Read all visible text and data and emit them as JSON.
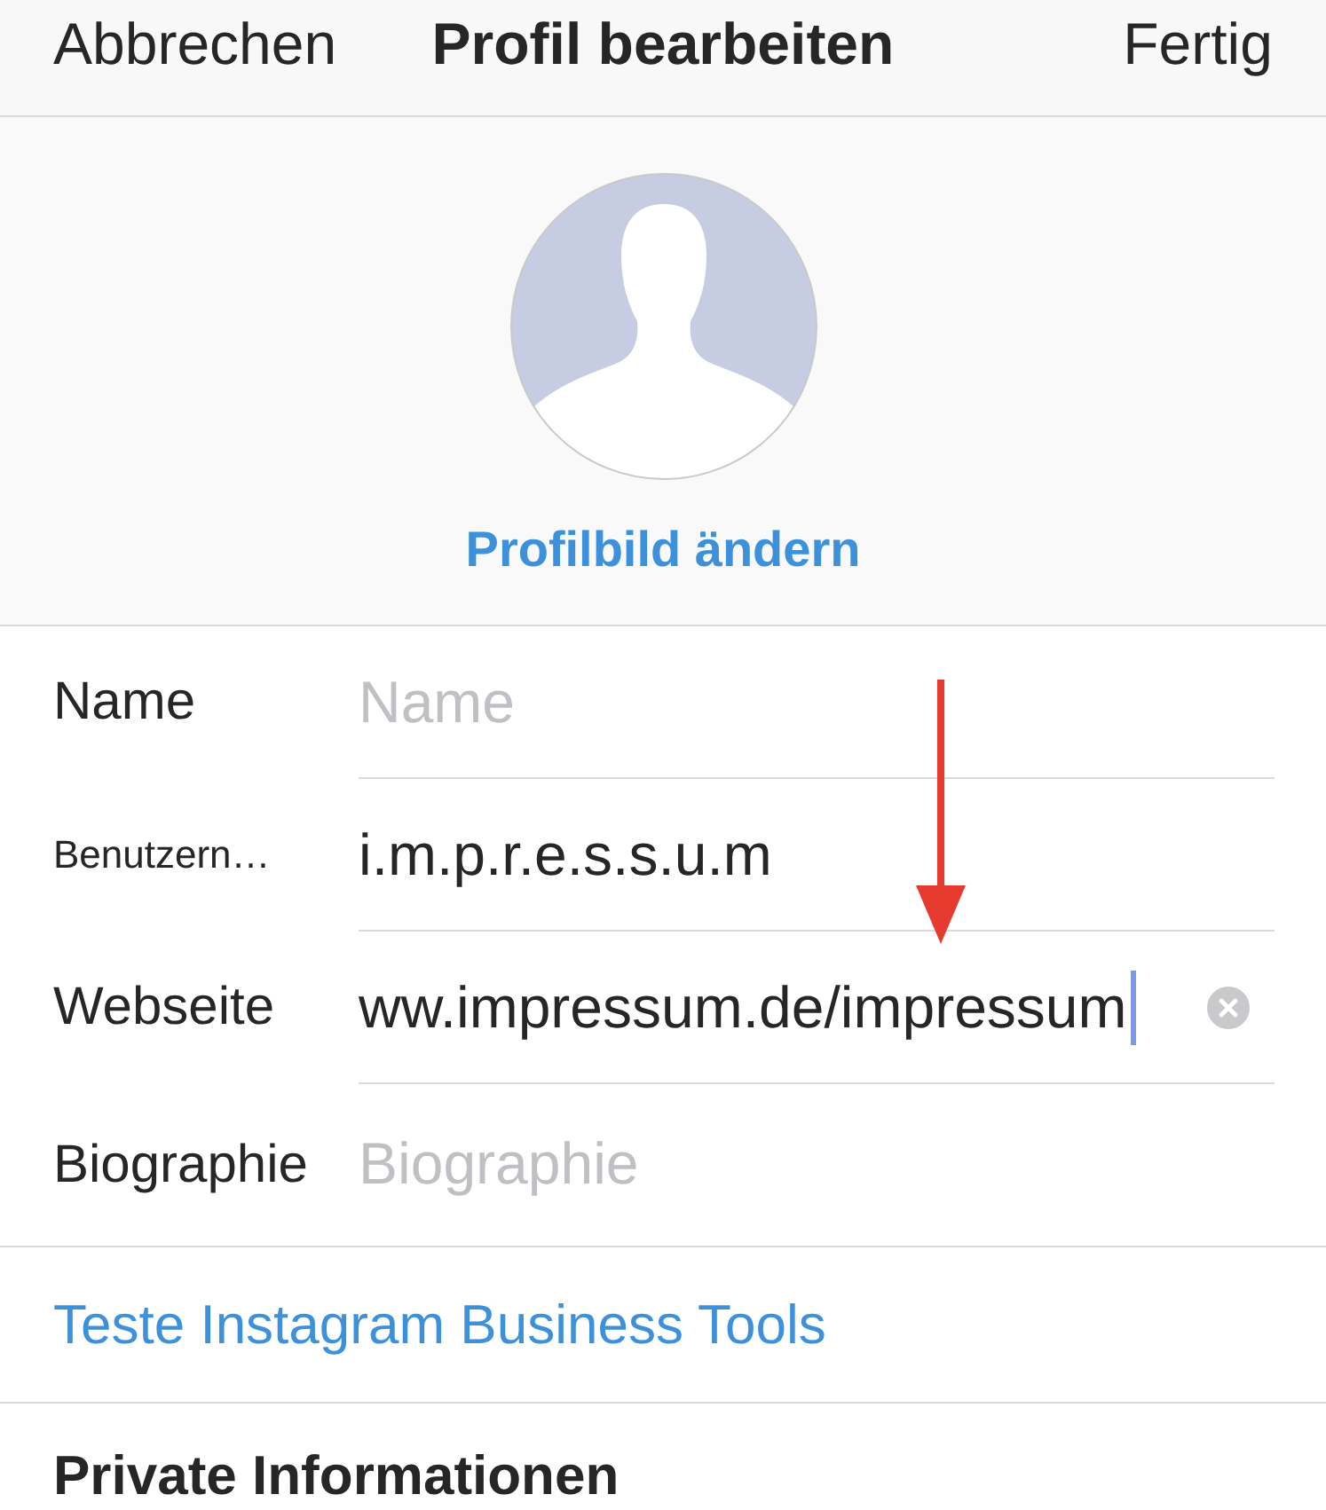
{
  "header": {
    "cancel": "Abbrechen",
    "title": "Profil bearbeiten",
    "done": "Fertig"
  },
  "profile_photo": {
    "action": "Profilbild ändern"
  },
  "fields": [
    {
      "label": "Name",
      "label_truncated": false,
      "placeholder": "Name",
      "focused": false
    },
    {
      "label": "Benutzern…",
      "label_truncated": true,
      "value": "i.m.p.r.e.s.s.u.m",
      "focused": false
    },
    {
      "label": "Webseite",
      "label_truncated": false,
      "value": "ww.impressum.de/impressum",
      "focused": true
    },
    {
      "label": "Biographie",
      "label_truncated": false,
      "placeholder": "Biographie",
      "focused": false
    }
  ],
  "annotations": [
    {
      "kind": "arrow"
    }
  ],
  "business_link": "Teste Instagram Business Tools",
  "private_section": {
    "title": "Private Informationen"
  }
}
